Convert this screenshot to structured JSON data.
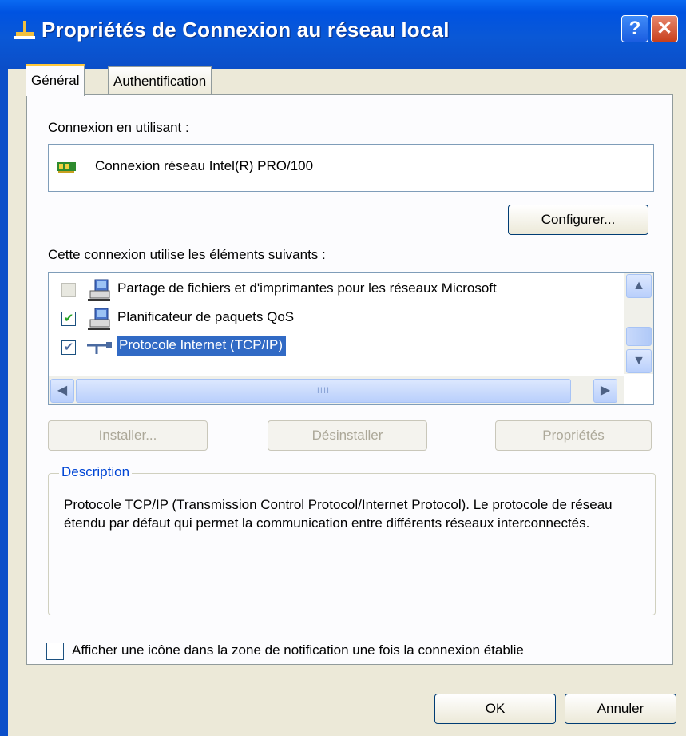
{
  "window": {
    "title": "Propriétés de Connexion au réseau local",
    "help_glyph": "?",
    "close_glyph": "✕"
  },
  "tabs": [
    {
      "label": "Général"
    },
    {
      "label": "Authentification"
    }
  ],
  "general": {
    "connect_using_label": "Connexion en utilisant :",
    "adapter_name": "Connexion réseau Intel(R) PRO/100",
    "configure_button": "Configurer...",
    "components_label": "Cette connexion utilise les éléments suivants :",
    "components": [
      {
        "label": "Partage de fichiers et d'imprimantes pour les réseaux Microsoft",
        "checked": false,
        "disabled": true,
        "icon": "network-computer-icon"
      },
      {
        "label": "Planificateur de paquets QoS",
        "checked": true,
        "disabled": false,
        "icon": "network-computer-icon"
      },
      {
        "label": "Protocole Internet (TCP/IP)",
        "checked": true,
        "disabled": false,
        "selected": true,
        "icon": "protocol-icon"
      }
    ],
    "scroll_thumb_grip": "IIII",
    "install_button": "Installer...",
    "uninstall_button": "Désinstaller",
    "properties_button": "Propriétés",
    "description_legend": "Description",
    "description_text": "Protocole TCP/IP (Transmission Control Protocol/Internet Protocol). Le protocole de réseau étendu par défaut qui permet la communication entre différents réseaux interconnectés.",
    "notify_checkbox_label": "Afficher une icône dans la zone de notification une fois la connexion établie",
    "notify_checked": false
  },
  "footer": {
    "ok_button": "OK",
    "cancel_button": "Annuler"
  }
}
